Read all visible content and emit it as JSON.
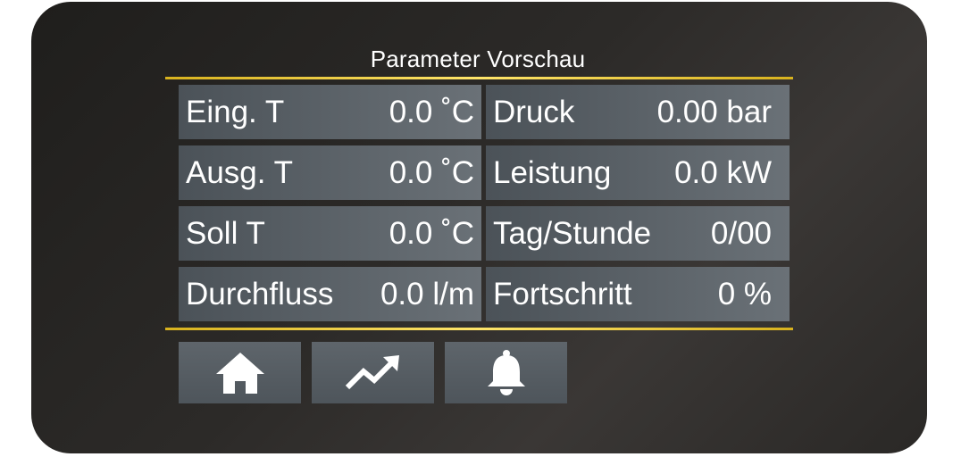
{
  "screen": {
    "title": "Parameter Vorschau"
  },
  "parameters": {
    "left": [
      {
        "label": "Eing. T",
        "value": "0.0 ˚C"
      },
      {
        "label": "Ausg. T",
        "value": "0.0 ˚C"
      },
      {
        "label": "Soll T",
        "value": "0.0 ˚C"
      },
      {
        "label": "Durchfluss",
        "value": "0.0 l/m"
      }
    ],
    "right": [
      {
        "label": "Druck",
        "value": "0.00 bar"
      },
      {
        "label": "Leistung",
        "value": "0.0 kW"
      },
      {
        "label": "Tag/Stunde",
        "value": "0/00"
      },
      {
        "label": "Fortschritt",
        "value": "0 %"
      }
    ]
  },
  "nav": {
    "icons": [
      "home-icon",
      "trend-icon",
      "bell-icon"
    ]
  },
  "colors": {
    "accent": "#e8c83a",
    "panel_bg": "#2c2a28",
    "cell_bg": "#5a6167",
    "text": "#ffffff"
  }
}
